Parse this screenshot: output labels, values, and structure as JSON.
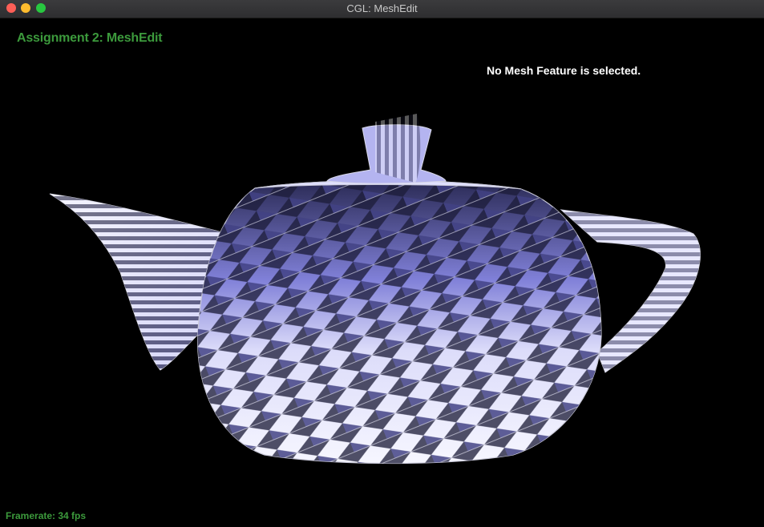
{
  "window": {
    "title": "CGL: MeshEdit"
  },
  "viewport": {
    "heading": "Assignment 2: MeshEdit",
    "status_text": "No Mesh Feature is selected.",
    "framerate": "Framerate: 34 fps"
  },
  "mesh": {
    "model": "teapot-icon"
  },
  "colors": {
    "background": "#000000",
    "accent_text": "#3c9a3c",
    "mesh_light": "#eeeeff",
    "mesh_mid": "#9999ee",
    "mesh_dark": "#1d1d3a",
    "wire": "#c8c8d8"
  }
}
